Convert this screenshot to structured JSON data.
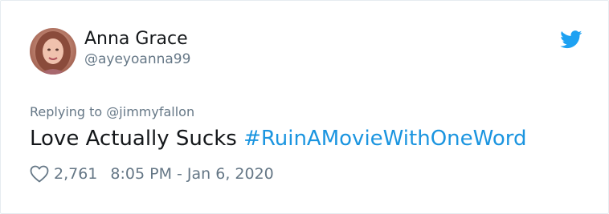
{
  "author": {
    "name": "Anna Grace",
    "handle": "@ayeyoanna99"
  },
  "reply": {
    "prefix": "Replying to ",
    "to": "@jimmyfallon"
  },
  "tweet": {
    "text": "Love Actually Sucks ",
    "hashtag": "#RuinAMovieWithOneWord"
  },
  "meta": {
    "likes": "2,761",
    "timestamp": "8:05 PM - Jan 6, 2020"
  },
  "icons": {
    "brand": "twitter-bird-icon",
    "like": "heart-outline-icon"
  },
  "colors": {
    "accent": "#1b95e0",
    "text": "#14171a",
    "secondary": "#657786"
  }
}
